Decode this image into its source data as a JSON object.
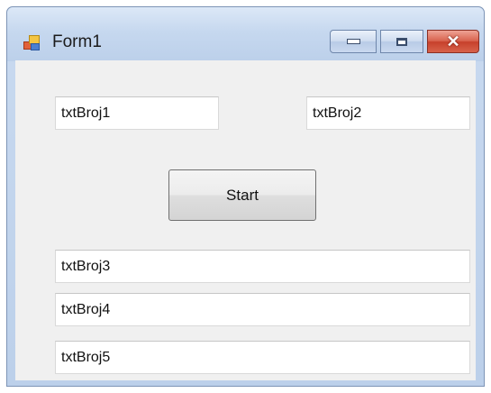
{
  "window": {
    "title": "Form1",
    "icon": "app-form-icon",
    "controls": {
      "minimize": "minimize-icon",
      "maximize": "maximize-icon",
      "close_glyph": "✕"
    }
  },
  "form": {
    "txtBroj1": "txtBroj1",
    "txtBroj2": "txtBroj2",
    "start_label": "Start",
    "txtBroj3": "txtBroj3",
    "txtBroj4": "txtBroj4",
    "txtBroj5": "txtBroj5"
  },
  "colors": {
    "titlebar": "#c6d8ef",
    "client_background": "#f0f0f0",
    "close_button": "#c7402b"
  }
}
